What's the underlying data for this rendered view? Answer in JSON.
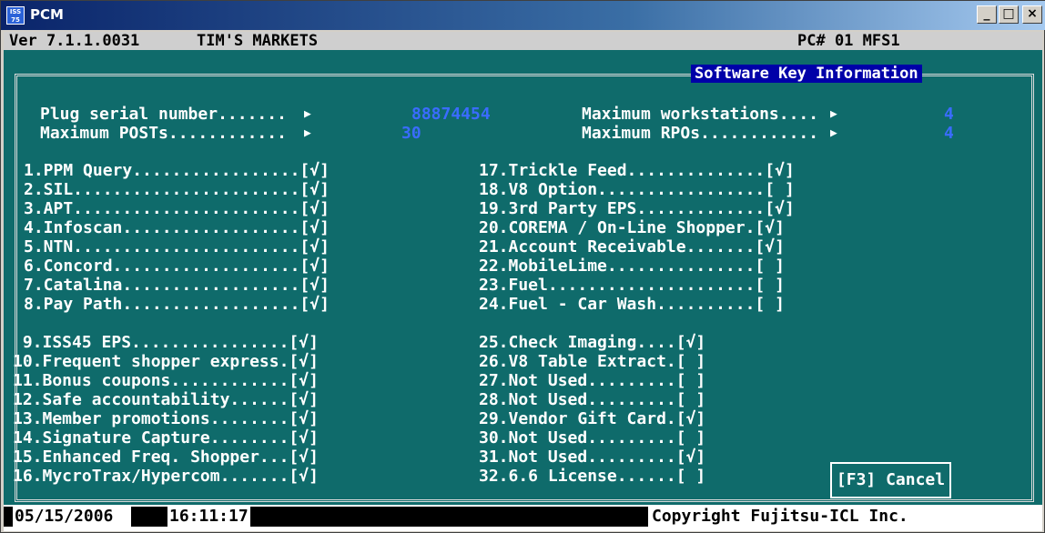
{
  "window": {
    "title": "PCM",
    "icon_text": "ISS\n75",
    "controls": [
      "minimize-icon",
      "maximize-icon",
      "close-icon"
    ],
    "controls_glyphs": [
      "_",
      "□",
      "×"
    ]
  },
  "header": {
    "version": "Ver 7.1.1.0031",
    "store": "TIM'S MARKETS",
    "pc": "PC# 01 MFS1"
  },
  "panel_title": "Software Key Information",
  "info": {
    "plug_serial_label": "Plug serial number.......",
    "plug_serial_value": "88874454",
    "max_posts_label": "Maximum POSTs............",
    "max_posts_value": "30",
    "max_workstations_label": "Maximum workstations....",
    "max_workstations_value": "4",
    "max_rpos_label": "Maximum RPOs............",
    "max_rpos_value": "4",
    "arrow_glyph": "▶"
  },
  "options_left_top": [
    "1.PPM Query.................[√]",
    "2.SIL.......................[√]",
    "3.APT.......................[√]",
    "4.Infoscan..................[√]",
    "5.NTN.......................[√]",
    "6.Concord...................[√]",
    "7.Catalina..................[√]",
    "8.Pay Path..................[√]"
  ],
  "options_right_top": [
    "17.Trickle Feed..............[√]",
    "18.V8 Option.................[ ]",
    "19.3rd Party EPS.............[√]",
    "20.COREMA / On-Line Shopper.[√]",
    "21.Account Receivable.......[√]",
    "22.MobileLime...............[ ]",
    "23.Fuel.....................[ ]",
    "24.Fuel - Car Wash..........[ ]"
  ],
  "options_left_bottom": [
    " 9.ISS45 EPS................[√]",
    "10.Frequent shopper express.[√]",
    "11.Bonus coupons............[√]",
    "12.Safe accountability......[√]",
    "13.Member promotions........[√]",
    "14.Signature Capture........[√]",
    "15.Enhanced Freq. Shopper...[√]",
    "16.MycroTrax/Hypercom.......[√]"
  ],
  "options_right_bottom": [
    "25.Check Imaging....[√]",
    "26.V8 Table Extract.[ ]",
    "27.Not Used.........[ ]",
    "28.Not Used.........[ ]",
    "29.Vendor Gift Card.[√]",
    "30.Not Used.........[ ]",
    "31.Not Used.........[√]",
    "32.6.6 License......[ ]"
  ],
  "cancel_button": "[F3] Cancel",
  "status": {
    "date": "05/15/2006",
    "time": "16:11:17",
    "copyright": "Copyright Fujitsu-ICL Inc."
  },
  "colors": {
    "terminal_bg": "#0f6b6b",
    "value_blue": "#3a6cff",
    "panel_title_bg": "#0000a8"
  }
}
